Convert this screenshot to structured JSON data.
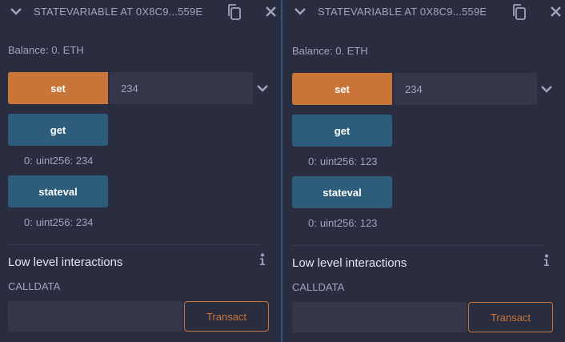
{
  "panels": [
    {
      "title": "STATEVARIABLE AT 0X8C9...559E",
      "balance": "Balance: 0. ETH",
      "set_label": "set",
      "set_value": "234",
      "get_label": "get",
      "get_result_index": "0:",
      "get_result_value": "uint256: 234",
      "stateval_label": "stateval",
      "stateval_result_index": "0:",
      "stateval_result_value": "uint256: 234",
      "low_level_title": "Low level interactions",
      "calldata_label": "CALLDATA",
      "transact_label": "Transact"
    },
    {
      "title": "STATEVARIABLE AT 0X8C9...559E",
      "balance": "Balance: 0. ETH",
      "set_label": "set",
      "set_value": "234",
      "get_label": "get",
      "get_result_index": "0:",
      "get_result_value": "uint256: 123",
      "stateval_label": "stateval",
      "stateval_result_index": "0:",
      "stateval_result_value": "uint256: 123",
      "low_level_title": "Low level interactions",
      "calldata_label": "CALLDATA",
      "transact_label": "Transact"
    }
  ],
  "icons": {
    "collapse": "chevron-down-icon",
    "copy": "copy-icon",
    "close": "close-icon",
    "expand_input": "chevron-down-icon",
    "info": "info-icon"
  },
  "colors": {
    "set_button": "#c97539",
    "call_button": "#2d5d7a",
    "panel_bg": "#2a2c3f",
    "divider": "#365379"
  }
}
